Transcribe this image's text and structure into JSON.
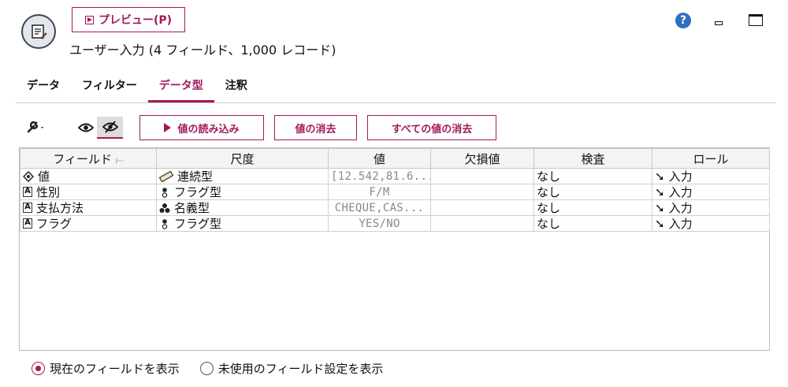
{
  "header": {
    "preview_label": "プレビュー(P)",
    "subtitle": "ユーザー入力 (4 フィールド、1,000 レコード)"
  },
  "window": {
    "help_icon": "question-circle-icon",
    "help_glyph": "?",
    "minimize_icon": "minimize-icon",
    "maximize_icon": "maximize-icon"
  },
  "tabs": [
    {
      "label": "データ",
      "active": false
    },
    {
      "label": "フィルター",
      "active": false
    },
    {
      "label": "データ型",
      "active": true
    },
    {
      "label": "注釈",
      "active": false
    }
  ],
  "toolbar": {
    "tools_icon": "wrench-icon",
    "read_values_label": "値の読み込み",
    "clear_values_label": "値の消去",
    "clear_all_values_label": "すべての値の消去"
  },
  "table": {
    "headers": [
      "フィールド",
      "尺度",
      "値",
      "欠損値",
      "検査",
      "ロール"
    ],
    "rows": [
      {
        "field": "値",
        "field_icon": "continuous-type-icon",
        "measure": "連続型",
        "measure_icon": "ruler-icon",
        "values": "[12.542,81.6...",
        "missing": "",
        "check": "なし",
        "role": "入力"
      },
      {
        "field": "性別",
        "field_icon": "string-type-icon",
        "measure": "フラグ型",
        "measure_icon": "flag-measure-icon",
        "values": "F/M",
        "missing": "",
        "check": "なし",
        "role": "入力"
      },
      {
        "field": "支払方法",
        "field_icon": "string-type-icon",
        "measure": "名義型",
        "measure_icon": "nominal-measure-icon",
        "values": "CHEQUE,CAS...",
        "missing": "",
        "check": "なし",
        "role": "入力"
      },
      {
        "field": "フラグ",
        "field_icon": "string-type-icon",
        "measure": "フラグ型",
        "measure_icon": "flag-measure-icon",
        "values": "YES/NO",
        "missing": "",
        "check": "なし",
        "role": "入力"
      }
    ]
  },
  "display_options": {
    "current_label": "現在のフィールドを表示",
    "unused_label": "未使用のフィールド設定を表示",
    "selected": "current"
  },
  "colors": {
    "accent": "#a3195b",
    "help": "#2f6fbd"
  }
}
